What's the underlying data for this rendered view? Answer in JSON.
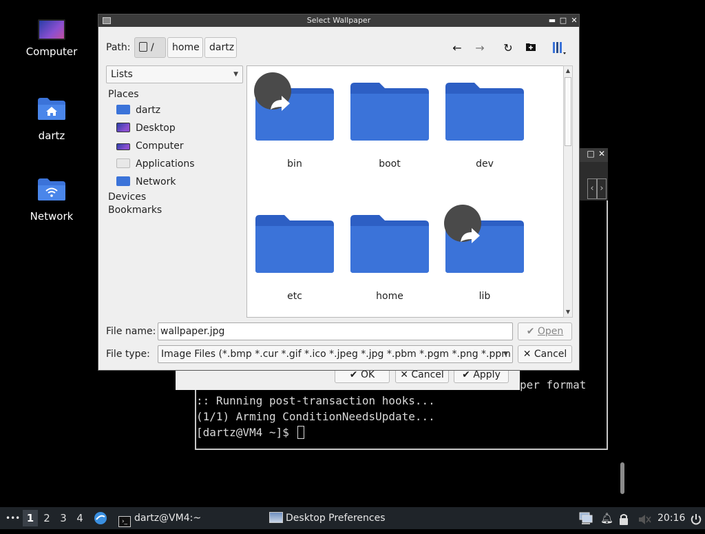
{
  "desktop": {
    "icons": [
      {
        "label": "Computer",
        "icon": "computer-icon"
      },
      {
        "label": "dartz",
        "icon": "home-folder-icon"
      },
      {
        "label": "Network",
        "icon": "network-folder-icon"
      }
    ]
  },
  "terminal": {
    "lines": [
      "per format",
      ":: Running post-transaction hooks...",
      "(1/1) Arming ConditionNeedsUpdate...",
      "[dartz@VM4 ~]$ "
    ]
  },
  "prefs_dialog": {
    "ok_label": "OK",
    "cancel_label": "Cancel",
    "apply_label": "Apply"
  },
  "file_dialog": {
    "title": "Select Wallpaper",
    "path_label": "Path:",
    "breadcrumbs": [
      "/",
      "home",
      "dartz"
    ],
    "view_mode": "Lists",
    "sidebar": {
      "places_header": "Places",
      "places": [
        {
          "label": "dartz",
          "icon": "home-folder-icon"
        },
        {
          "label": "Desktop",
          "icon": "desktop-icon"
        },
        {
          "label": "Computer",
          "icon": "computer-icon"
        },
        {
          "label": "Applications",
          "icon": "applications-icon"
        },
        {
          "label": "Network",
          "icon": "network-folder-icon"
        }
      ],
      "devices_header": "Devices",
      "bookmarks_header": "Bookmarks"
    },
    "files": [
      {
        "name": "bin",
        "symlink": true
      },
      {
        "name": "boot",
        "symlink": false
      },
      {
        "name": "dev",
        "symlink": false
      },
      {
        "name": "etc",
        "symlink": false
      },
      {
        "name": "home",
        "symlink": false
      },
      {
        "name": "lib",
        "symlink": true
      }
    ],
    "filename_label": "File name:",
    "filename_value": "wallpaper.jpg",
    "filetype_label": "File type:",
    "filetype_value": "Image Files (*.bmp *.cur *.gif *.ico *.jpeg *.jpg *.pbm *.pgm *.png *.ppm *.",
    "open_label": "Open",
    "cancel_label": "Cancel"
  },
  "taskbar": {
    "menu_glyph": "•••",
    "workspaces": [
      "1",
      "2",
      "3",
      "4"
    ],
    "active_workspace": "1",
    "tasks": [
      {
        "label": "dartz@VM4:~",
        "icon": "terminal-icon"
      },
      {
        "label": "Desktop Preferences",
        "icon": "desktop-preferences-icon"
      }
    ],
    "clock": "20:16"
  },
  "colors": {
    "folder": "#3b73d9",
    "folder_tab": "#2d5fc4",
    "taskbar": "#1f2429",
    "titlebar": "#3b3b3b"
  }
}
